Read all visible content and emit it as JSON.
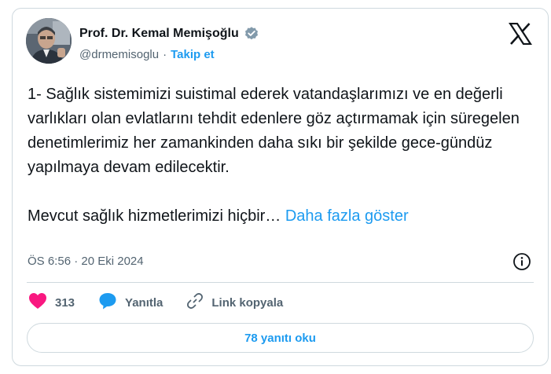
{
  "author": {
    "display_name": "Prof. Dr. Kemal Memişoğlu",
    "handle": "@drmemisoglu",
    "separator": "·",
    "follow_label": "Takip et"
  },
  "tweet": {
    "paragraph1": "1- Sağlık sistemimizi suistimal ederek vatandaşlarımızı ve en değerli varlıkları olan evlatlarını tehdit edenlere göz açtırmamak için  süregelen denetimlerimiz her zamankinden daha sıkı bir şekilde gece-gündüz yapılmaya devam edilecektir.",
    "paragraph2": "Mevcut sağlık hizmetlerimizi hiçbir…",
    "show_more": "Daha fazla göster",
    "timestamp": "ÖS 6:56 · 20 Eki 2024"
  },
  "actions": {
    "like_count": "313",
    "reply_label": "Yanıtla",
    "copy_link_label": "Link kopyala",
    "read_replies_label": "78 yanıtı oku"
  },
  "colors": {
    "accent": "#1d9bf0",
    "like": "#f91880",
    "text": "#0f1419",
    "muted": "#536471",
    "border": "#cfd9de"
  },
  "icons": {
    "verified": "verified-badge-icon",
    "x_logo": "x-logo-icon",
    "info": "info-icon",
    "heart": "heart-icon",
    "reply": "reply-bubble-icon",
    "link": "link-icon"
  }
}
